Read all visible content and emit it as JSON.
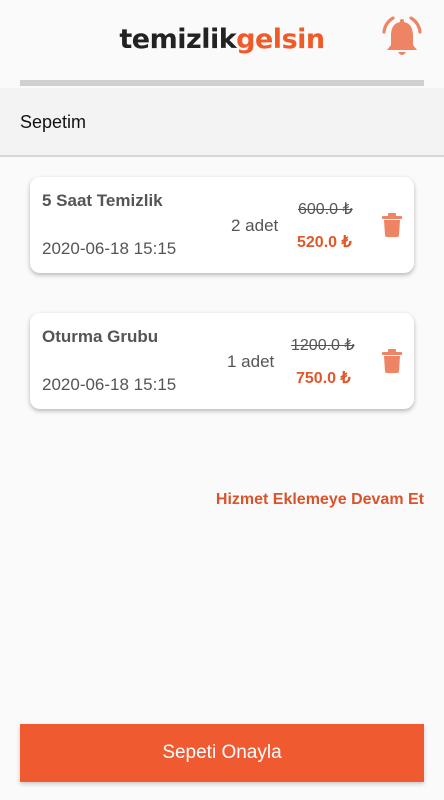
{
  "app": {
    "logo_part1": "temizlik",
    "logo_part2": "gelsin"
  },
  "colors": {
    "accent": "#f05a30",
    "price": "#e1572a",
    "icon": "#ee8463"
  },
  "header": {
    "bell_icon": "bell-icon"
  },
  "subheader": {
    "title": "Sepetim"
  },
  "cart": {
    "items": [
      {
        "title": "5 Saat Temizlik",
        "date": "2020-06-18 15:15",
        "quantity": "2 adet",
        "old_price": "600.0 ₺",
        "new_price": "520.0 ₺"
      },
      {
        "title": "Oturma Grubu",
        "date": "2020-06-18 15:15",
        "quantity": "1 adet",
        "old_price": "1200.0 ₺",
        "new_price": "750.0 ₺"
      }
    ]
  },
  "actions": {
    "continue_label": "Hizmet Eklemeye Devam Et",
    "confirm_label": "Sepeti Onayla"
  }
}
